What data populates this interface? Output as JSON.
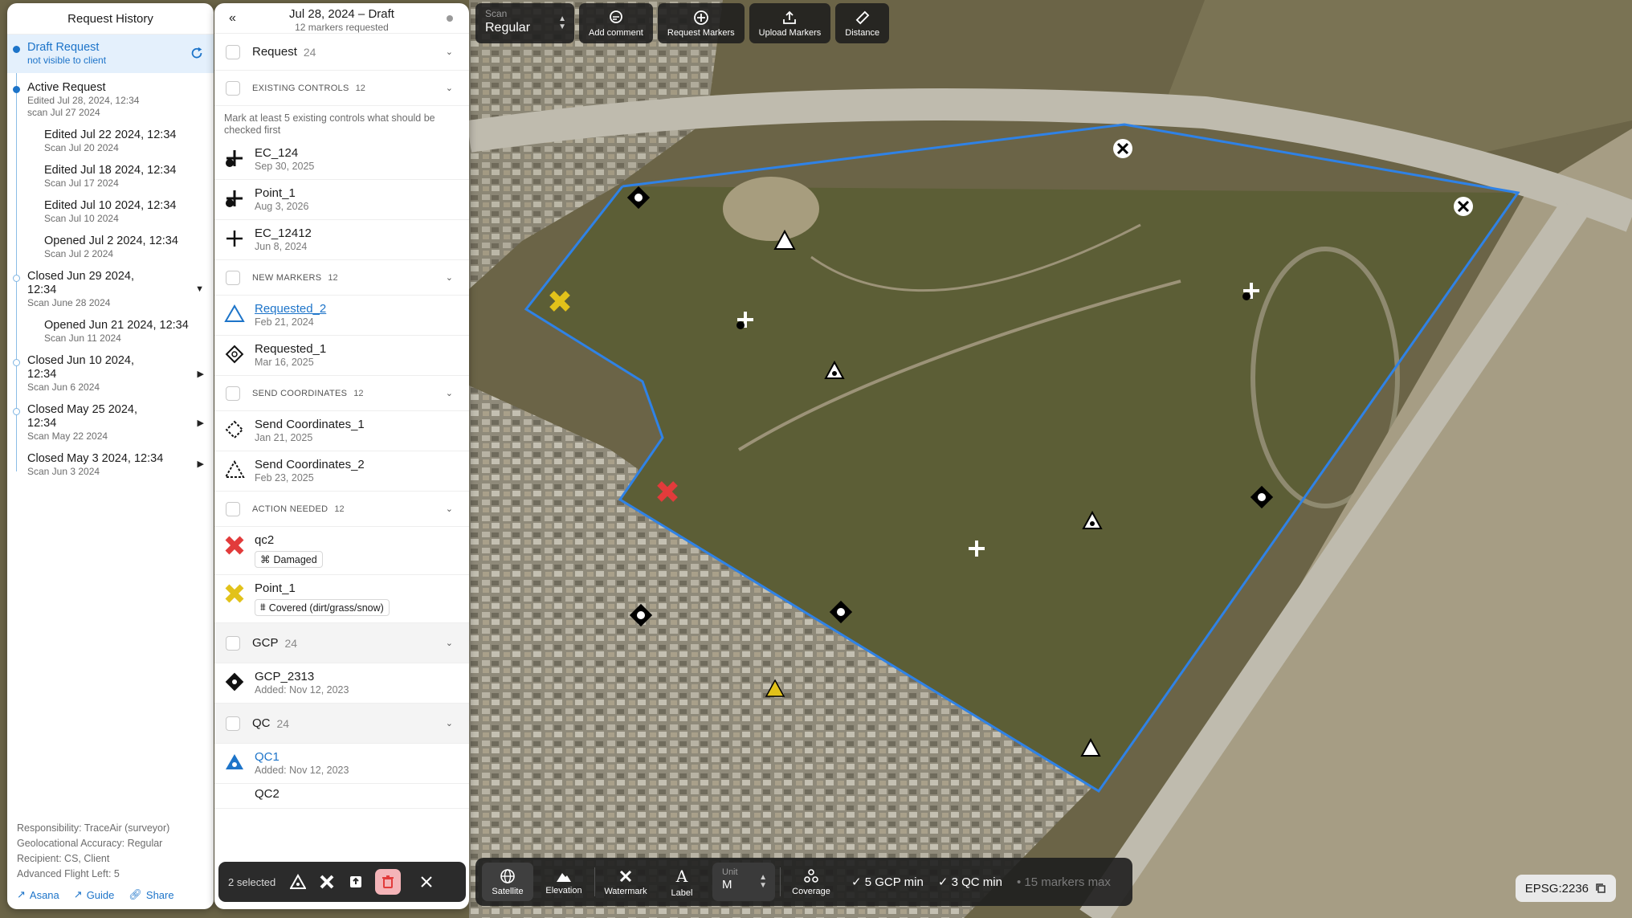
{
  "history": {
    "title": "Request History",
    "draft": {
      "title": "Draft Request",
      "subtitle": "not visible to client"
    },
    "active": {
      "title": "Active Request",
      "line1": "Edited Jul 28, 2024, 12:34",
      "line2": "scan Jul 27 2024"
    },
    "sub_items": [
      {
        "title": "Edited Jul 22 2024, 12:34",
        "subtitle": "Scan Jul 20 2024"
      },
      {
        "title": "Edited Jul 18 2024, 12:34",
        "subtitle": "Scan Jul 17 2024"
      },
      {
        "title": "Edited Jul 10 2024, 12:34",
        "subtitle": "Scan Jul 10 2024"
      },
      {
        "title": "Opened Jul 2 2024, 12:34",
        "subtitle": "Scan Jul 2 2024"
      }
    ],
    "closed_1": {
      "title": "Closed Jun 29 2024,",
      "title2": "12:34",
      "subtitle": "Scan June 28 2024"
    },
    "closed_1_sub": {
      "title": "Opened Jun 21 2024, 12:34",
      "subtitle": "Scan Jun 11 2024"
    },
    "closed_2": {
      "title": "Closed Jun 10 2024,",
      "title2": "12:34",
      "subtitle": "Scan Jun 6 2024"
    },
    "closed_3": {
      "title": "Closed May 25 2024,",
      "title2": "12:34",
      "subtitle": "Scan May 22 2024"
    },
    "closed_4": {
      "title": "Closed May 3 2024, 12:34",
      "subtitle": "Scan Jun 3 2024"
    },
    "footer": {
      "responsibility": "Responsibility: TraceAir (surveyor)",
      "accuracy": "Geolocational Accuracy: Regular",
      "recipient": "Recipient: CS, Client",
      "flights": "Advanced Flight Left: 5"
    },
    "links": {
      "asana": "Asana",
      "guide": "Guide",
      "share": "Share"
    }
  },
  "markers": {
    "title": "Jul 28, 2024 – Draft",
    "subtitle": "12 markers requested",
    "request": {
      "name": "Request",
      "count": "24"
    },
    "existing": {
      "name": "EXISTING CONTROLS",
      "count": "12",
      "note": "Mark at least 5 existing controls what should be checked first",
      "items": [
        {
          "name": "EC_124",
          "date": "Sep 30, 2025"
        },
        {
          "name": "Point_1",
          "date": "Aug 3, 2026"
        },
        {
          "name": "EC_12412",
          "date": "Jun 8, 2024"
        }
      ]
    },
    "new": {
      "name": "NEW MARKERS",
      "count": "12",
      "items": [
        {
          "name": "Requested_2",
          "date": "Feb 21, 2024"
        },
        {
          "name": "Requested_1",
          "date": "Mar 16, 2025"
        }
      ]
    },
    "send": {
      "name": "SEND COORDINATES",
      "count": "12",
      "items": [
        {
          "name": "Send Coordinates_1",
          "date": "Jan 21, 2025"
        },
        {
          "name": "Send Coordinates_2",
          "date": "Feb 23, 2025"
        }
      ]
    },
    "action": {
      "name": "ACTION NEEDED",
      "count": "12",
      "items": [
        {
          "name": "qc2",
          "tag": "Damaged"
        },
        {
          "name": "Point_1",
          "tag": "Covered (dirt/grass/snow)"
        }
      ]
    },
    "gcp": {
      "name": "GCP",
      "count": "24",
      "item": {
        "name": "GCP_2313",
        "date": "Added: Nov 12, 2023"
      }
    },
    "qc": {
      "name": "QC",
      "count": "24",
      "item": {
        "name": "QC1",
        "date": "Added: Nov 12, 2023"
      },
      "partial": "QC2"
    }
  },
  "selection": {
    "count": "2 selected"
  },
  "toolbar": {
    "scan_label": "Scan",
    "scan_value": "Regular",
    "add_comment": "Add comment",
    "request_markers": "Request Markers",
    "upload_markers": "Upload Markers",
    "distance": "Distance"
  },
  "bottom": {
    "satellite": "Satellite",
    "elevation": "Elevation",
    "watermark": "Watermark",
    "label": "Label",
    "unit_label": "Unit",
    "unit_value": "M",
    "coverage": "Coverage",
    "gcp_min": "5 GCP min",
    "qc_min": "3 QC min",
    "markers_max": "15 markers max"
  },
  "epsg": "EPSG:2236",
  "colors": {
    "accent": "#1d74c9",
    "danger": "#e23b3b",
    "warning": "#e2c21a"
  }
}
